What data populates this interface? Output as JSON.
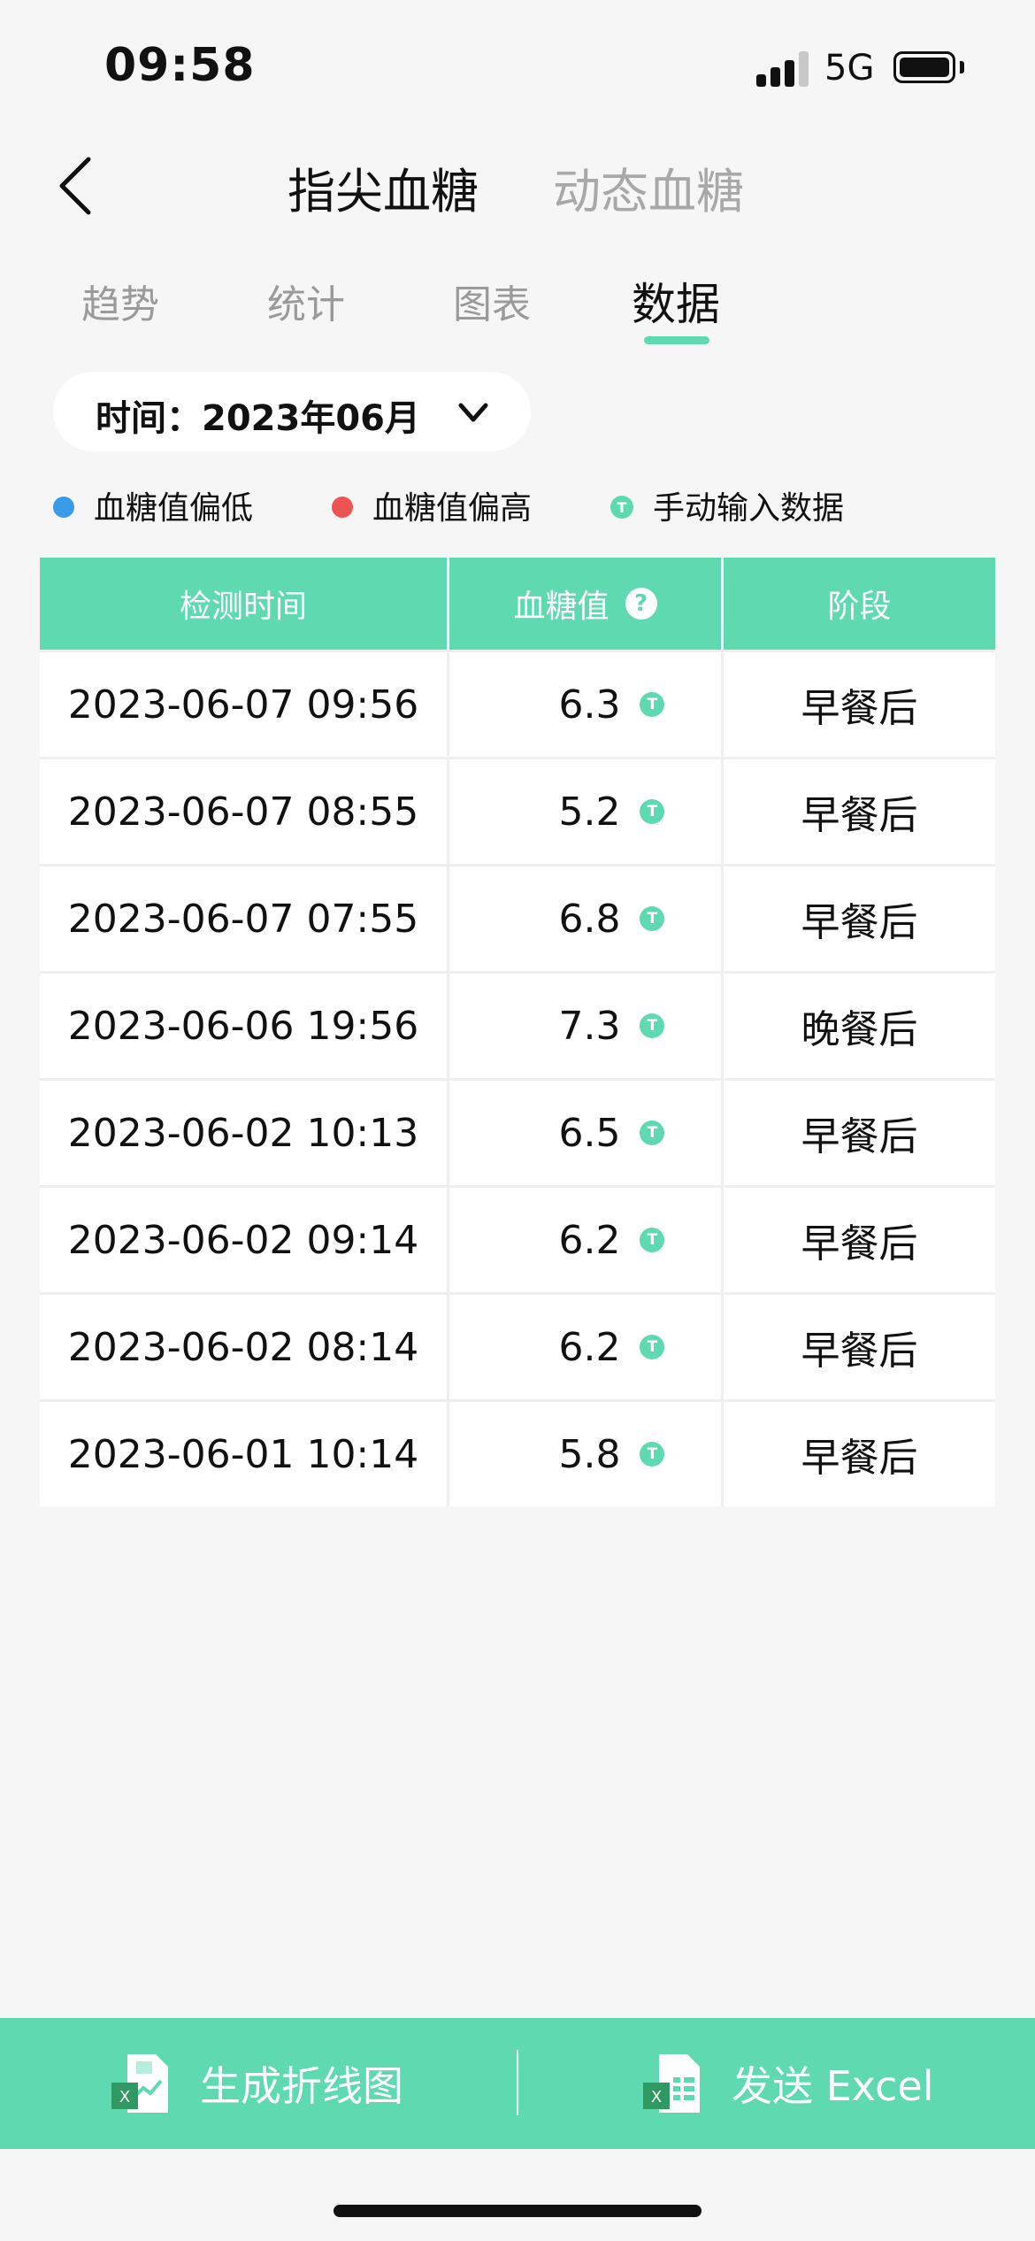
{
  "status": {
    "time": "09:58",
    "network": "5G"
  },
  "header": {
    "title_active": "指尖血糖",
    "title_inactive": "动态血糖"
  },
  "tabs": [
    {
      "label": "趋势"
    },
    {
      "label": "统计"
    },
    {
      "label": "图表"
    },
    {
      "label": "数据",
      "active": true
    }
  ],
  "filter": {
    "time_label": "时间：2023年06月"
  },
  "legend": [
    {
      "label": "血糖值偏低",
      "color": "#3a9be8"
    },
    {
      "label": "血糖值偏高",
      "color": "#ef5454"
    },
    {
      "label": "手动输入数据",
      "color": "#5ed9b0",
      "mark": "T"
    }
  ],
  "table": {
    "headers": [
      "检测时间",
      "血糖值",
      "阶段"
    ],
    "manual_mark": "T",
    "rows": [
      {
        "time": "2023-06-07 09:56",
        "value": "6.3",
        "stage": "早餐后"
      },
      {
        "time": "2023-06-07 08:55",
        "value": "5.2",
        "stage": "早餐后"
      },
      {
        "time": "2023-06-07 07:55",
        "value": "6.8",
        "stage": "早餐后"
      },
      {
        "time": "2023-06-06 19:56",
        "value": "7.3",
        "stage": "晚餐后"
      },
      {
        "time": "2023-06-02 10:13",
        "value": "6.5",
        "stage": "早餐后"
      },
      {
        "time": "2023-06-02 09:14",
        "value": "6.2",
        "stage": "早餐后"
      },
      {
        "time": "2023-06-02 08:14",
        "value": "6.2",
        "stage": "早餐后"
      },
      {
        "time": "2023-06-01 10:14",
        "value": "5.8",
        "stage": "早餐后"
      }
    ]
  },
  "actions": {
    "chart_label": "生成折线图",
    "excel_label": "发送 Excel"
  },
  "colors": {
    "accent": "#5ed9b0",
    "low": "#3a9be8",
    "high": "#ef5454"
  }
}
